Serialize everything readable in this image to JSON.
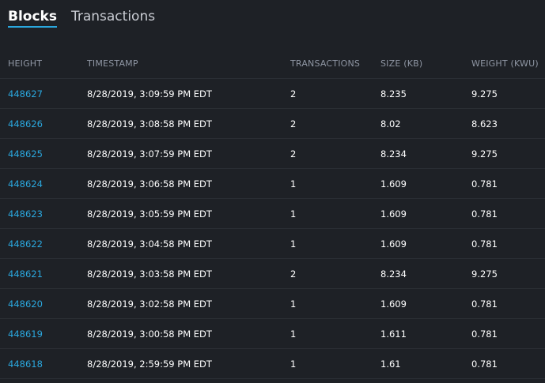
{
  "tabs": [
    {
      "label": "Blocks",
      "active": true
    },
    {
      "label": "Transactions",
      "active": false
    }
  ],
  "table": {
    "columns": [
      "HEIGHT",
      "TIMESTAMP",
      "TRANSACTIONS",
      "SIZE (KB)",
      "WEIGHT (KWU)"
    ],
    "rows": [
      {
        "height": "448627",
        "timestamp": "8/28/2019, 3:09:59 PM EDT",
        "transactions": "2",
        "size": "8.235",
        "weight": "9.275"
      },
      {
        "height": "448626",
        "timestamp": "8/28/2019, 3:08:58 PM EDT",
        "transactions": "2",
        "size": "8.02",
        "weight": "8.623"
      },
      {
        "height": "448625",
        "timestamp": "8/28/2019, 3:07:59 PM EDT",
        "transactions": "2",
        "size": "8.234",
        "weight": "9.275"
      },
      {
        "height": "448624",
        "timestamp": "8/28/2019, 3:06:58 PM EDT",
        "transactions": "1",
        "size": "1.609",
        "weight": "0.781"
      },
      {
        "height": "448623",
        "timestamp": "8/28/2019, 3:05:59 PM EDT",
        "transactions": "1",
        "size": "1.609",
        "weight": "0.781"
      },
      {
        "height": "448622",
        "timestamp": "8/28/2019, 3:04:58 PM EDT",
        "transactions": "1",
        "size": "1.609",
        "weight": "0.781"
      },
      {
        "height": "448621",
        "timestamp": "8/28/2019, 3:03:58 PM EDT",
        "transactions": "2",
        "size": "8.234",
        "weight": "9.275"
      },
      {
        "height": "448620",
        "timestamp": "8/28/2019, 3:02:58 PM EDT",
        "transactions": "1",
        "size": "1.609",
        "weight": "0.781"
      },
      {
        "height": "448619",
        "timestamp": "8/28/2019, 3:00:58 PM EDT",
        "transactions": "1",
        "size": "1.611",
        "weight": "0.781"
      },
      {
        "height": "448618",
        "timestamp": "8/28/2019, 2:59:59 PM EDT",
        "transactions": "1",
        "size": "1.61",
        "weight": "0.781"
      }
    ]
  },
  "colors": {
    "background": "#1e2126",
    "accent": "#2aa7de",
    "header_text": "#8f96a3",
    "divider": "#2b2f35"
  }
}
